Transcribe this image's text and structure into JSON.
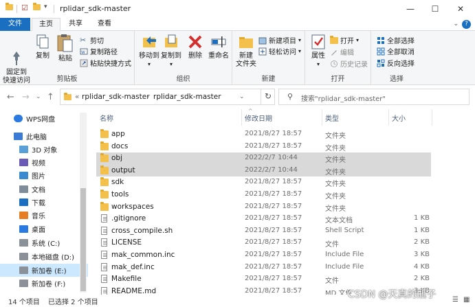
{
  "window": {
    "title": "rplidar_sdk-master",
    "minimize": "—",
    "maximize": "☐",
    "close": "✕"
  },
  "ribbon_tabs": [
    "文件",
    "主页",
    "共享",
    "查看"
  ],
  "ribbon": {
    "clipboard": {
      "pin_label": "固定到\n快速访问",
      "copy_label": "复制",
      "paste_label": "粘贴",
      "cut_label": "剪切",
      "copy_path_label": "复制路径",
      "paste_shortcut_label": "粘贴快捷方式",
      "group_label": "剪贴板"
    },
    "organize": {
      "move_to_label": "移动到",
      "copy_to_label": "复制到",
      "delete_label": "删除",
      "rename_label": "重命名",
      "group_label": "组织"
    },
    "new": {
      "new_folder_label": "新建\n文件夹",
      "new_item_label": "新建项目",
      "easy_access_label": "轻松访问",
      "group_label": "新建"
    },
    "open": {
      "properties_label": "属性",
      "open_label": "打开",
      "edit_label": "编辑",
      "history_label": "历史记录",
      "group_label": "打开"
    },
    "select": {
      "select_all_label": "全部选择",
      "select_none_label": "全部取消",
      "invert_label": "反向选择",
      "group_label": "选择"
    }
  },
  "address": {
    "crumb_prefix": "«",
    "crumb1": "rplidar_sdk-master",
    "crumb_arrow": "›",
    "crumb2": "rplidar_sdk-master",
    "search_placeholder": "搜索\"rplidar_sdk-master\""
  },
  "sidebar": {
    "items": [
      {
        "label": "WPS网盘",
        "icon": "cloud-icon"
      },
      {
        "label": "此电脑",
        "icon": "computer-icon"
      },
      {
        "label": "3D 对象",
        "icon": "cube-icon"
      },
      {
        "label": "视频",
        "icon": "video-icon"
      },
      {
        "label": "图片",
        "icon": "picture-icon"
      },
      {
        "label": "文档",
        "icon": "document-icon"
      },
      {
        "label": "下载",
        "icon": "download-icon"
      },
      {
        "label": "音乐",
        "icon": "music-icon"
      },
      {
        "label": "桌面",
        "icon": "desktop-icon"
      },
      {
        "label": "系统 (C:)",
        "icon": "drive-icon"
      },
      {
        "label": "本地磁盘 (D:)",
        "icon": "drive-icon"
      },
      {
        "label": "新加卷 (E:)",
        "icon": "drive-icon"
      },
      {
        "label": "新加卷 (F:)",
        "icon": "drive-icon"
      }
    ]
  },
  "columns": {
    "name": "名称",
    "date": "修改日期",
    "type": "类型",
    "size": "大小"
  },
  "files": [
    {
      "name": "app",
      "date": "2021/8/27 18:57",
      "type": "文件夹",
      "size": "",
      "kind": "folder"
    },
    {
      "name": "docs",
      "date": "2021/8/27 18:57",
      "type": "文件夹",
      "size": "",
      "kind": "folder"
    },
    {
      "name": "obj",
      "date": "2022/2/7 10:44",
      "type": "文件夹",
      "size": "",
      "kind": "folder"
    },
    {
      "name": "output",
      "date": "2022/2/7 10:44",
      "type": "文件夹",
      "size": "",
      "kind": "folder"
    },
    {
      "name": "sdk",
      "date": "2021/8/27 18:57",
      "type": "文件夹",
      "size": "",
      "kind": "folder"
    },
    {
      "name": "tools",
      "date": "2021/8/27 18:57",
      "type": "文件夹",
      "size": "",
      "kind": "folder"
    },
    {
      "name": "workspaces",
      "date": "2021/8/27 18:57",
      "type": "文件夹",
      "size": "",
      "kind": "folder"
    },
    {
      "name": ".gitignore",
      "date": "2021/8/27 18:57",
      "type": "文本文档",
      "size": "1 KB",
      "kind": "doc"
    },
    {
      "name": "cross_compile.sh",
      "date": "2021/8/27 18:57",
      "type": "Shell Script",
      "size": "1 KB",
      "kind": "doc"
    },
    {
      "name": "LICENSE",
      "date": "2021/8/27 18:57",
      "type": "文件",
      "size": "2 KB",
      "kind": "doc"
    },
    {
      "name": "mak_common.inc",
      "date": "2021/8/27 18:57",
      "type": "Include File",
      "size": "3 KB",
      "kind": "doc"
    },
    {
      "name": "mak_def.inc",
      "date": "2021/8/27 18:57",
      "type": "Include File",
      "size": "4 KB",
      "kind": "doc"
    },
    {
      "name": "Makefile",
      "date": "2021/8/27 18:57",
      "type": "文件",
      "size": "2 KB",
      "kind": "doc"
    },
    {
      "name": "README.md",
      "date": "2021/8/27 18:57",
      "type": "MD 文件",
      "size": "3 KB",
      "kind": "doc"
    }
  ],
  "status": {
    "count": "14 个项目",
    "selected": "已选择 2 个项目"
  },
  "watermark": "CSDN @天真的瓶子",
  "colors": {
    "accent": "#1a6fc0",
    "folder": "#f3c04c",
    "selection": "#d9d9d9",
    "nav_selected": "#cce8ff"
  }
}
